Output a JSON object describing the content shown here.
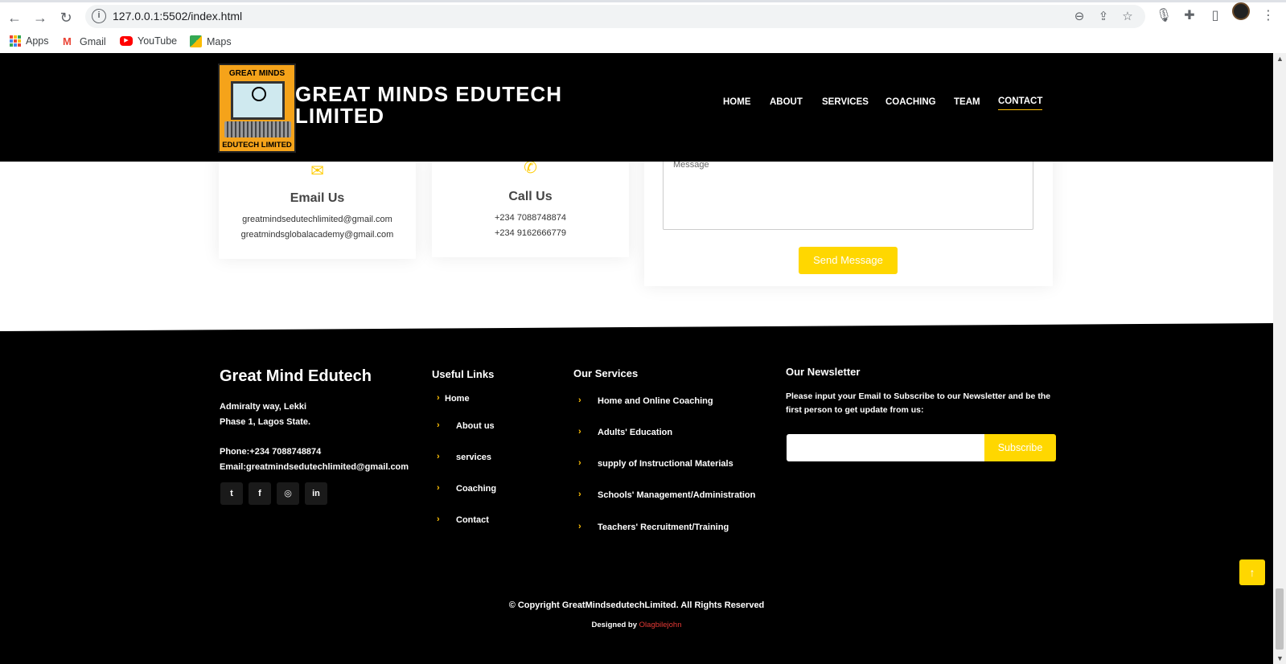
{
  "browser": {
    "url": "127.0.0.1:5502/index.html",
    "bookmarks": [
      {
        "label": "Apps",
        "icon": "apps-grid-icon"
      },
      {
        "label": "Gmail",
        "icon": "gmail-icon"
      },
      {
        "label": "YouTube",
        "icon": "youtube-icon"
      },
      {
        "label": "Maps",
        "icon": "maps-icon"
      }
    ]
  },
  "header": {
    "logo_top_text": "GREAT MINDS",
    "logo_bottom_text": "EDUTECH LIMITED",
    "title_line1": "GREAT MINDS EDUTECH",
    "title_line2": "LIMITED",
    "nav": [
      {
        "label": "HOME"
      },
      {
        "label": "ABOUT"
      },
      {
        "label": "SERVICES"
      },
      {
        "label": "COACHING"
      },
      {
        "label": "TEAM"
      },
      {
        "label": "CONTACT",
        "active": true
      }
    ],
    "accent_color": "#ffc107"
  },
  "contact": {
    "email_card": {
      "title": "Email Us",
      "lines": [
        "greatmindsedutechlimited@gmail.com",
        "greatmindsglobalacademy@gmail.com"
      ]
    },
    "call_card": {
      "title": "Call Us",
      "lines": [
        "+234 7088748874",
        "+234 9162666779"
      ]
    },
    "message_placeholder": "Message",
    "send_label": "Send Message"
  },
  "footer": {
    "brand": "Great Mind Edutech",
    "address_line1": "Admiralty way, Lekki",
    "address_line2": "Phase 1, Lagos State.",
    "phone": "Phone:+234 7088748874",
    "email": "Email:greatmindsedutechlimited@gmail.com",
    "social": [
      {
        "icon": "twitter-icon",
        "glyph": "t"
      },
      {
        "icon": "facebook-icon",
        "glyph": "f"
      },
      {
        "icon": "instagram-icon",
        "glyph": "◎"
      },
      {
        "icon": "linkedin-icon",
        "glyph": "in"
      }
    ],
    "useful_links_title": "Useful Links",
    "useful_links": [
      "Home",
      "About us",
      "services",
      "Coaching",
      "Contact"
    ],
    "services_title": "Our Services",
    "services": [
      "Home and Online Coaching",
      "Adults' Education",
      "supply of Instructional Materials",
      "Schools' Management/Administration",
      "Teachers' Recruitment/Training"
    ],
    "newsletter_title": "Our Newsletter",
    "newsletter_text_line1": "Please input your Email to Subscribe to our Newsletter and be the",
    "newsletter_text_line2": "first person to get update from us:",
    "subscribe_label": "Subscribe",
    "copyright": "© Copyright GreatMindsedutechLimited. All Rights Reserved",
    "designed_by": "Designed by",
    "designer": "Olagbilejohn"
  }
}
